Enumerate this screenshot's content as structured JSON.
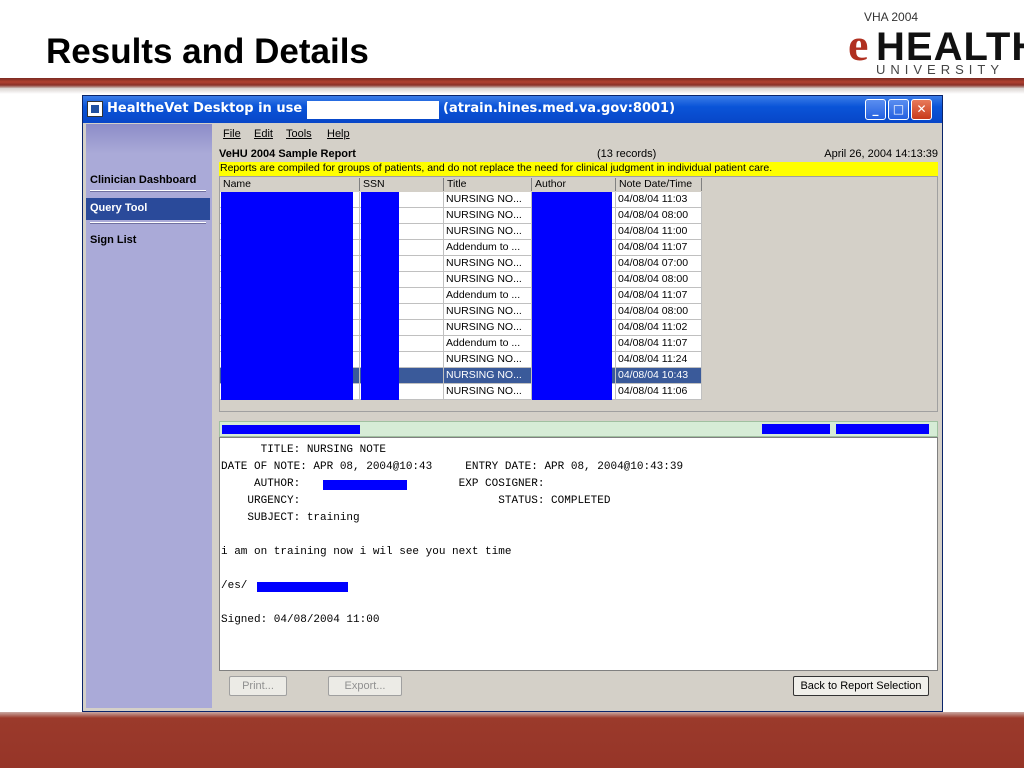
{
  "slide": {
    "title": "Results and Details",
    "logo": {
      "top": "VHA 2004",
      "e": "e",
      "main": "HEALTH",
      "sub": "UNIVERSITY"
    }
  },
  "window": {
    "title_prefix": "HealtheVet Desktop in use by:",
    "title_suffix": "(atrain.hines.med.va.gov:8001)",
    "buttons": {
      "minimize": "_",
      "maximize": "□",
      "close": "✕"
    }
  },
  "sidebar": {
    "items": [
      {
        "label": "Clinician Dashboard"
      },
      {
        "label": "Query Tool"
      },
      {
        "label": "Sign List"
      }
    ]
  },
  "menu": {
    "items": [
      "File",
      "Edit",
      "Tools",
      "Help"
    ]
  },
  "report": {
    "name": "VeHU 2004 Sample Report",
    "count": "(13 records)",
    "date": "April 26, 2004 14:13:39",
    "warning": "Reports are compiled for groups of patients, and do not replace the need for clinical judgment in individual patient care."
  },
  "table": {
    "columns": [
      "Name",
      "SSN",
      "Title",
      "Author",
      "Note Date/Time"
    ],
    "rows": [
      {
        "title": "NURSING NO...",
        "datetime": "04/08/04 11:03"
      },
      {
        "title": "NURSING NO...",
        "datetime": "04/08/04 08:00"
      },
      {
        "title": "NURSING NO...",
        "datetime": "04/08/04 11:00"
      },
      {
        "title": "Addendum to ...",
        "datetime": "04/08/04 11:07"
      },
      {
        "title": "NURSING NO...",
        "datetime": "04/08/04 07:00"
      },
      {
        "title": "NURSING NO...",
        "datetime": "04/08/04 08:00"
      },
      {
        "title": "Addendum to ...",
        "datetime": "04/08/04 11:07"
      },
      {
        "title": "NURSING NO...",
        "datetime": "04/08/04 08:00"
      },
      {
        "title": "NURSING NO...",
        "datetime": "04/08/04 11:02"
      },
      {
        "title": "Addendum to ...",
        "datetime": "04/08/04 11:07"
      },
      {
        "title": "NURSING NO...",
        "datetime": "04/08/04 11:24"
      },
      {
        "title": "NURSING NO...",
        "datetime": "04/08/04 10:43"
      },
      {
        "title": "NURSING NO...",
        "datetime": "04/08/04 11:06"
      }
    ],
    "selected_index": 11
  },
  "note": {
    "text": "      TITLE: NURSING NOTE\nDATE OF NOTE: APR 08, 2004@10:43     ENTRY DATE: APR 08, 2004@10:43:39\n     AUTHOR:                        EXP COSIGNER:\n    URGENCY:                              STATUS: COMPLETED\n    SUBJECT: training\n\ni am on training now i wil see you next time\n\n/es/\n\nSigned: 04/08/2004 11:00"
  },
  "buttons": {
    "print": "Print...",
    "export": "Export...",
    "back": "Back to Report Selection"
  }
}
